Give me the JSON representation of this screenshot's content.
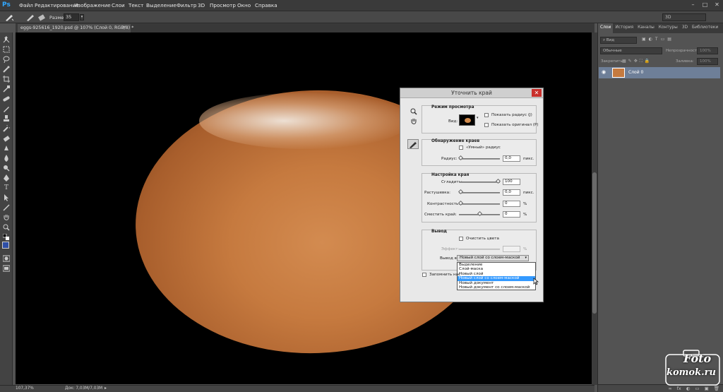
{
  "app": {
    "logo": "Ps"
  },
  "menu": [
    "Файл",
    "Редактирование",
    "Изображение",
    "Слои",
    "Текст",
    "Выделение",
    "Фильтр",
    "3D",
    "Просмотр",
    "Окно",
    "Справка"
  ],
  "window_controls": {
    "minimize": "–",
    "maximize": "□",
    "close": "✕"
  },
  "options": {
    "size_label": "Размер:",
    "size_value": "35",
    "workspace": "3D"
  },
  "document": {
    "tab_title": "eggs-925616_1920.psd @ 107% (Слой 0, RGB/8) *",
    "close": "×"
  },
  "status": {
    "zoom": "107,37%",
    "doc_size": "Док: 7,03M/7,03M"
  },
  "panel": {
    "tabs": [
      "Слои",
      "История",
      "Каналы",
      "Контуры",
      "3D",
      "Библиотеки"
    ],
    "kind": "Вид",
    "blend": "Обычные",
    "opacity_label": "Непрозрачность:",
    "opacity": "100%",
    "lock_label": "Закрепить:",
    "fill_label": "Заливка:",
    "fill": "100%",
    "layer_name": "Слой 0",
    "bottom_icons": [
      "fx",
      "◐",
      "▭",
      "▣",
      "🗑"
    ]
  },
  "dialog": {
    "title": "Уточнить край",
    "close": "✕",
    "view_mode": {
      "title": "Режим просмотра",
      "view_label": "Вид:",
      "show_radius": "Показать радиус (J)",
      "show_original": "Показать оригинал (P)"
    },
    "edge_detection": {
      "title": "Обнаружение краев",
      "smart_radius": "«Умный» радиус",
      "radius_label": "Радиус:",
      "radius_value": "0,0",
      "radius_unit": "пикс."
    },
    "adjust_edge": {
      "title": "Настройка края",
      "smooth_label": "Сгладить:",
      "smooth_value": "100",
      "feather_label": "Растушевка:",
      "feather_value": "0,0",
      "feather_unit": "пикс.",
      "contrast_label": "Контрастность:",
      "contrast_value": "0",
      "contrast_unit": "%",
      "shift_label": "Сместить край:",
      "shift_value": "0",
      "shift_unit": "%"
    },
    "output": {
      "title": "Вывод",
      "decontaminate": "Очистить цвета",
      "amount_label": "Эффект:",
      "amount_unit": "%",
      "output_to_label": "Вывод в:",
      "output_to_value": "Новый слой со слоем-маской",
      "options": [
        "Выделение",
        "Слой-маска",
        "Новый слой",
        "Новый слой со слоем-маской",
        "Новый документ",
        "Новый документ со слоем-маской"
      ],
      "selected_index": 3
    },
    "remember_label": "Запомнить нас"
  },
  "watermark": {
    "line1": "Foto",
    "line2": "komok.ru"
  },
  "colors": {
    "accent": "#3399ff",
    "ps_blue": "#31a8ff",
    "close_red": "#c9302c",
    "layer_selected": "#6e7f98"
  }
}
